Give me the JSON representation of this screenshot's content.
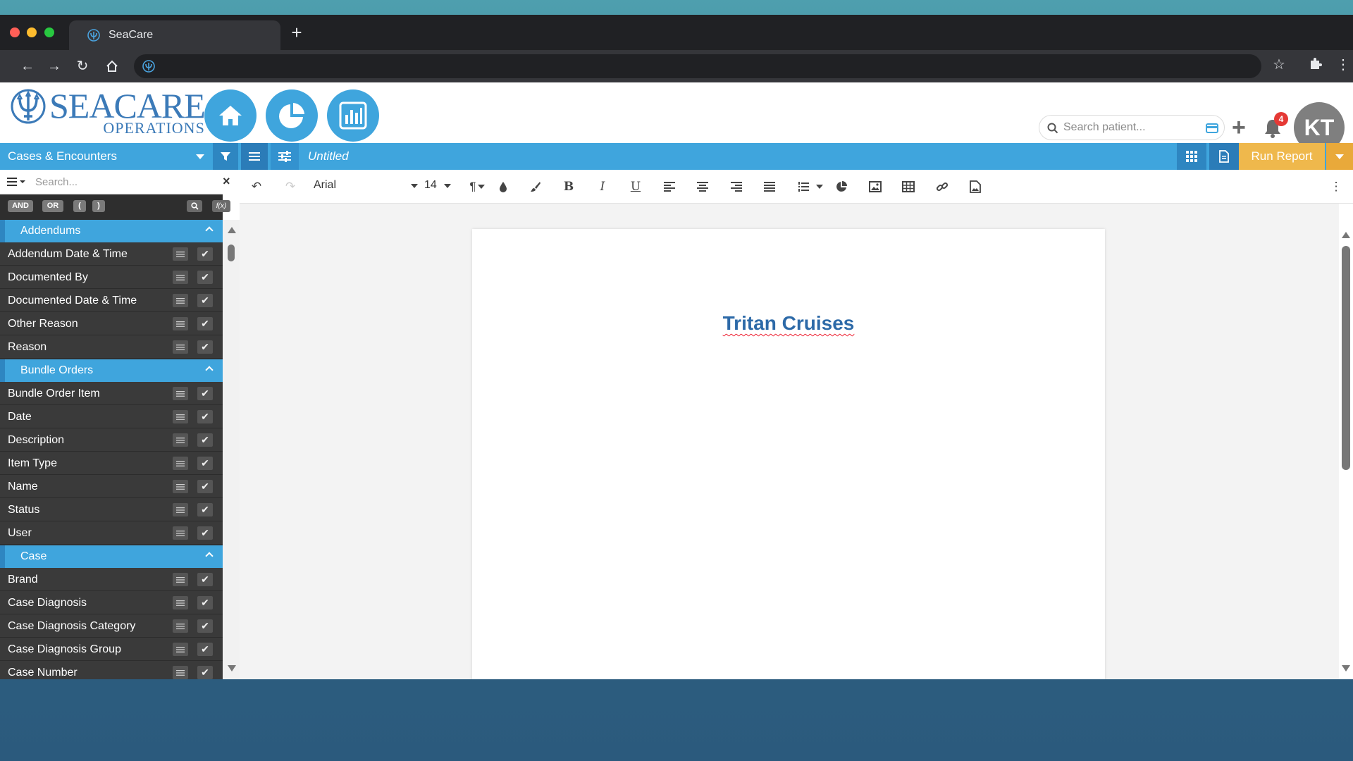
{
  "browser": {
    "tab_title": "SeaCare",
    "new_tab_label": "+"
  },
  "header": {
    "logo_main": "SEACARE",
    "logo_sub": "OPERATIONS",
    "search_placeholder": "Search patient...",
    "notification_count": "4",
    "avatar_initials": "KT"
  },
  "bluebar": {
    "source": "Cases & Encounters",
    "doc_title": "Untitled",
    "run_report": "Run Report"
  },
  "left_panel": {
    "search_placeholder": "Search...",
    "logic_buttons": [
      "AND",
      "OR",
      "(",
      ")"
    ],
    "fx_label": "f(x)",
    "groups": [
      {
        "label": "Addendums",
        "items": [
          "Addendum Date & Time",
          "Documented By",
          "Documented Date & Time",
          "Other Reason",
          "Reason"
        ]
      },
      {
        "label": "Bundle Orders",
        "items": [
          "Bundle Order Item",
          "Date",
          "Description",
          "Item Type",
          "Name",
          "Status",
          "User"
        ]
      },
      {
        "label": "Case",
        "items": [
          "Brand",
          "Case Diagnosis",
          "Case Diagnosis Category",
          "Case Diagnosis Group",
          "Case Number"
        ]
      }
    ]
  },
  "editor": {
    "font_family": "Arial",
    "font_size": "14",
    "content_heading": "Tritan Cruises",
    "heading_color": "#2d6aa8"
  },
  "colors": {
    "accent": "#3fa5dd",
    "run_button": "#efb84c",
    "panel_bg": "#3a3a3a",
    "badge": "#e53935"
  }
}
